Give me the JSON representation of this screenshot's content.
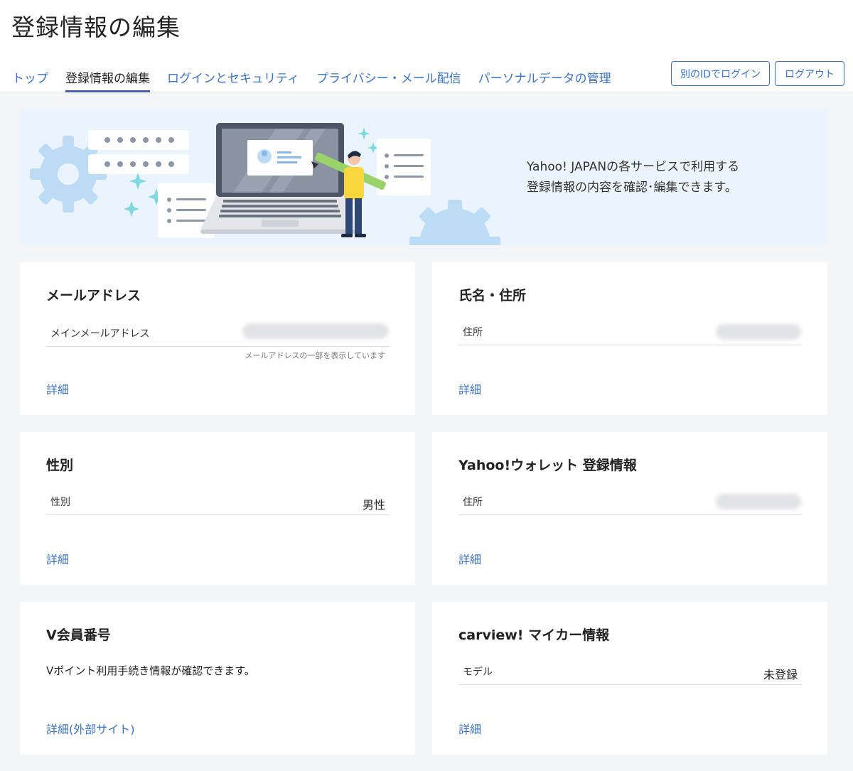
{
  "page_title": "登録情報の編集",
  "tabs": [
    {
      "label": "トップ"
    },
    {
      "label": "登録情報の編集"
    },
    {
      "label": "ログインとセキュリティ"
    },
    {
      "label": "プライバシー・メール配信"
    },
    {
      "label": "パーソナルデータの管理"
    }
  ],
  "header_buttons": {
    "other_login": "別のIDでログイン",
    "logout": "ログアウト"
  },
  "banner": {
    "line1": "Yahoo! JAPANの各サービスで利用する",
    "line2": "登録情報の内容を確認･編集できます。"
  },
  "cards": {
    "email": {
      "title": "メールアドレス",
      "row_label": "メインメールアドレス",
      "note": "メールアドレスの一部を表示しています",
      "link": "詳細"
    },
    "name_address": {
      "title": "氏名・住所",
      "row_label": "住所",
      "link": "詳細"
    },
    "gender": {
      "title": "性別",
      "row_label": "性別",
      "row_value": "男性",
      "link": "詳細"
    },
    "wallet": {
      "title": "Yahoo!ウォレット 登録情報",
      "row_label": "住所",
      "link": "詳細"
    },
    "v_member": {
      "title": "V会員番号",
      "description": "Vポイント利用手続き情報が確認できます。",
      "link": "詳細(外部サイト)"
    },
    "carview": {
      "title": "carview! マイカー情報",
      "row_label": "モデル",
      "row_value": "未登録",
      "link": "詳細"
    }
  },
  "colors": {
    "link": "#3a72c6",
    "tab_underline": "#4a5eb3",
    "background": "#f4f5f7",
    "banner_bg": "#ebf4fd"
  }
}
